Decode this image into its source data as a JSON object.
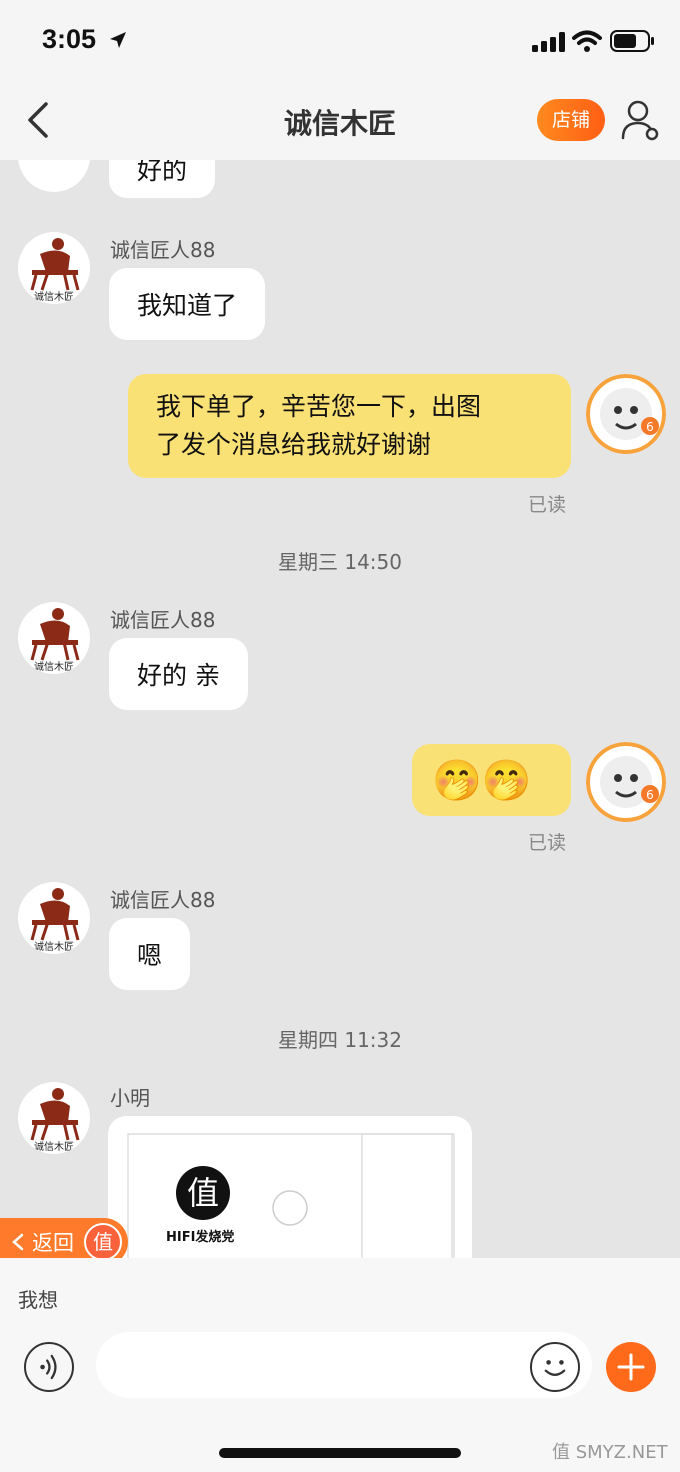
{
  "status": {
    "time": "3:05"
  },
  "nav": {
    "title": "诚信木匠",
    "shop_label": "店铺"
  },
  "messages": {
    "m0": "好的",
    "m1_sender": "诚信匠人88",
    "m1": "我知道了",
    "m2_line1": "我下单了，辛苦您一下，出图",
    "m2_line2": "了发个消息给我就好谢谢",
    "read": "已读",
    "ts1": "星期三 14:50",
    "m3_sender": "诚信匠人88",
    "m3": "好的 亲",
    "m4": "🤭🤭",
    "m5_sender": "诚信匠人88",
    "m5": "嗯",
    "ts2": "星期四 11:32",
    "m6_sender": "小明",
    "card_brand_char": "值",
    "card_brand_text": "HIFI发烧党"
  },
  "float": {
    "return_label": "返回",
    "badge": "值"
  },
  "composer": {
    "suggestion": "我想",
    "input_value": ""
  },
  "watermark": "值 SMYZ.NET",
  "colors": {
    "accent": "#ff6a1a",
    "my_bubble": "#fae176",
    "shop_avatar": "#8a2a17"
  }
}
